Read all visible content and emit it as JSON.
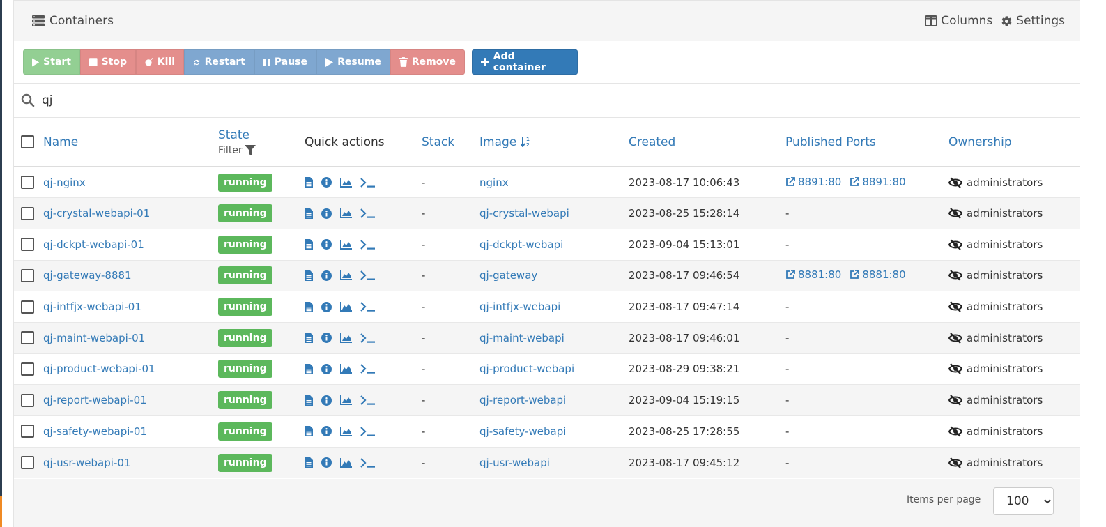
{
  "header": {
    "title": "Containers",
    "columns_label": "Columns",
    "settings_label": "Settings"
  },
  "toolbar": {
    "start": "Start",
    "stop": "Stop",
    "kill": "Kill",
    "restart": "Restart",
    "pause": "Pause",
    "resume": "Resume",
    "remove": "Remove",
    "add": "Add container"
  },
  "search": {
    "value": "qj"
  },
  "table": {
    "headers": {
      "name": "Name",
      "state": "State",
      "state_filter": "Filter",
      "quick_actions": "Quick actions",
      "stack": "Stack",
      "image": "Image",
      "created": "Created",
      "ports": "Published Ports",
      "ownership": "Ownership"
    },
    "rows": [
      {
        "name": "qj-nginx",
        "state": "running",
        "stack": "-",
        "image": "nginx",
        "created": "2023-08-17 10:06:43",
        "ports": [
          "8891:80",
          "8891:80"
        ],
        "ownership": "administrators"
      },
      {
        "name": "qj-crystal-webapi-01",
        "state": "running",
        "stack": "-",
        "image": "qj-crystal-webapi",
        "created": "2023-08-25 15:28:14",
        "ports": [],
        "ports_text": "-",
        "ownership": "administrators"
      },
      {
        "name": "qj-dckpt-webapi-01",
        "state": "running",
        "stack": "-",
        "image": "qj-dckpt-webapi",
        "created": "2023-09-04 15:13:01",
        "ports": [],
        "ports_text": "-",
        "ownership": "administrators"
      },
      {
        "name": "qj-gateway-8881",
        "state": "running",
        "stack": "-",
        "image": "qj-gateway",
        "created": "2023-08-17 09:46:54",
        "ports": [
          "8881:80",
          "8881:80"
        ],
        "ownership": "administrators"
      },
      {
        "name": "qj-intfjx-webapi-01",
        "state": "running",
        "stack": "-",
        "image": "qj-intfjx-webapi",
        "created": "2023-08-17 09:47:14",
        "ports": [],
        "ports_text": "-",
        "ownership": "administrators"
      },
      {
        "name": "qj-maint-webapi-01",
        "state": "running",
        "stack": "-",
        "image": "qj-maint-webapi",
        "created": "2023-08-17 09:46:01",
        "ports": [],
        "ports_text": "-",
        "ownership": "administrators"
      },
      {
        "name": "qj-product-webapi-01",
        "state": "running",
        "stack": "-",
        "image": "qj-product-webapi",
        "created": "2023-08-29 09:38:21",
        "ports": [],
        "ports_text": "-",
        "ownership": "administrators"
      },
      {
        "name": "qj-report-webapi-01",
        "state": "running",
        "stack": "-",
        "image": "qj-report-webapi",
        "created": "2023-09-04 15:19:15",
        "ports": [],
        "ports_text": "-",
        "ownership": "administrators"
      },
      {
        "name": "qj-safety-webapi-01",
        "state": "running",
        "stack": "-",
        "image": "qj-safety-webapi",
        "created": "2023-08-25 17:28:55",
        "ports": [],
        "ports_text": "-",
        "ownership": "administrators"
      },
      {
        "name": "qj-usr-webapi-01",
        "state": "running",
        "stack": "-",
        "image": "qj-usr-webapi",
        "created": "2023-08-17 09:45:12",
        "ports": [],
        "ports_text": "-",
        "ownership": "administrators"
      }
    ]
  },
  "footer": {
    "items_per_page_label": "Items per page",
    "items_per_page": "100"
  },
  "colors": {
    "link": "#337ab7",
    "running": "#5cb85c",
    "primary": "#337ab7",
    "success_light": "#93cf93",
    "danger_light": "#e48e8c",
    "info_light": "#7fa7d0"
  }
}
